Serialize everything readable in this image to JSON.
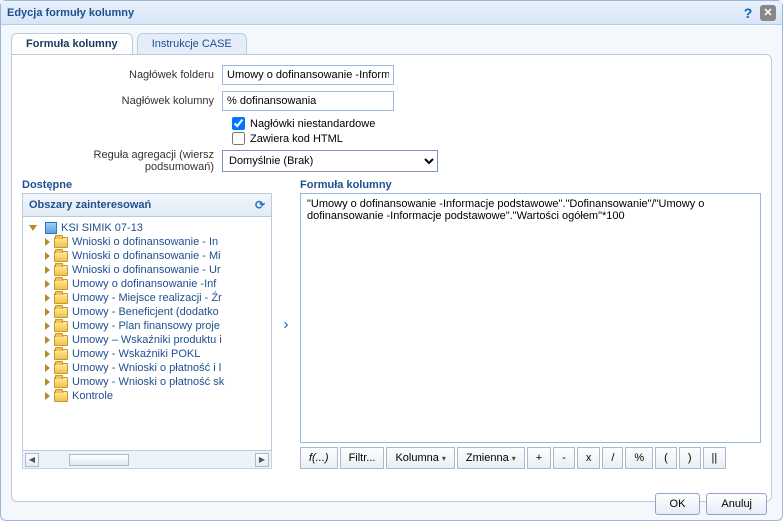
{
  "window": {
    "title": "Edycja formuły kolumny"
  },
  "tabs": {
    "formula": "Formuła kolumny",
    "case": "Instrukcje CASE"
  },
  "form": {
    "folderHeaderLabel": "Nagłówek folderu",
    "folderHeaderValue": "Umowy o dofinansowanie -Informa",
    "columnHeaderLabel": "Nagłówek kolumny",
    "columnHeaderValue": "% dofinansowania",
    "customHeadersLabel": "Nagłówki niestandardowe",
    "containsHtmlLabel": "Zawiera kod HTML",
    "aggRuleLabel": "Reguła agregacji (wiersz podsumowań)",
    "aggRuleValue": "Domyślnie (Brak)"
  },
  "left": {
    "title": "Dostępne",
    "subjectHeader": "Obszary zainteresowań",
    "root": "KSI SIMIK 07-13",
    "items": [
      "Wnioski o dofinansowanie - In",
      "Wnioski o dofinansowanie - Mi",
      "Wnioski o dofinansowanie - Ur",
      "Umowy o dofinansowanie -Inf",
      "Umowy - Miejsce realizacji - Źr",
      "Umowy - Beneficjent (dodatko",
      "Umowy - Plan finansowy proje",
      "Umowy – Wskaźniki produktu i",
      "Umowy - Wskaźniki POKL",
      "Umowy - Wnioski o płatność i l",
      "Umowy - Wnioski o płatność sk",
      "Kontrole"
    ]
  },
  "right": {
    "title": "Formuła kolumny",
    "formula": "\"Umowy o dofinansowanie -Informacje podstawowe\".\"Dofinansowanie\"/\"Umowy o dofinansowanie -Informacje podstawowe\".\"Wartości ogółem\"*100"
  },
  "toolbar": {
    "fn": "f(...)",
    "filter": "Filtr...",
    "column": "Kolumna",
    "variable": "Zmienna",
    "plus": "+",
    "minus": "-",
    "mult": "x",
    "div": "/",
    "pct": "%",
    "lp": "(",
    "rp": ")",
    "pipe": "||"
  },
  "buttons": {
    "ok": "OK",
    "cancel": "Anuluj"
  }
}
